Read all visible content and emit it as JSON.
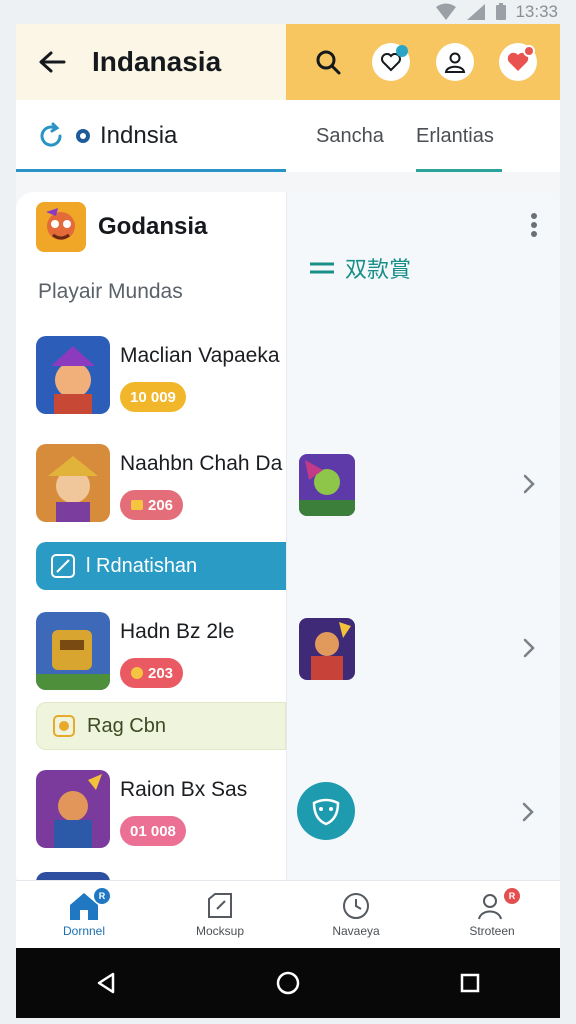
{
  "status_bar": {
    "time": "13:33"
  },
  "header": {
    "title": "Indanasia",
    "icons": [
      "back-arrow-icon",
      "search-icon",
      "heart-chat-icon",
      "profile-icon",
      "notification-heart-icon"
    ]
  },
  "tabs": {
    "active_label": "Indnsia",
    "items": [
      "Sancha",
      "Erlantias"
    ]
  },
  "game": {
    "name": "Godansia",
    "section_label": "Playair Mundas"
  },
  "list": [
    {
      "name": "Maclian Vapaeka",
      "badge": "10 009",
      "badge_color": "#f2b62a"
    },
    {
      "name": "Naahbn Chah Da",
      "badge": "206",
      "badge_color": "#e36d78"
    },
    {
      "name": "Hadn Bz 2le",
      "badge": "203",
      "badge_color": "#ea5a63"
    },
    {
      "name": "Raion Bx Sas",
      "badge": "01 008",
      "badge_color": "#ec6f94"
    }
  ],
  "banners": {
    "blue": "l Rdnatishan",
    "green": "Rag Cbn"
  },
  "panel": {
    "title": "双款賞"
  },
  "bottom_nav": [
    {
      "label": "Dornnel",
      "active": true,
      "badge": "R"
    },
    {
      "label": "Mocksup",
      "active": false,
      "badge": ""
    },
    {
      "label": "Navaeya",
      "active": false,
      "badge": ""
    },
    {
      "label": "Stroteen",
      "active": false,
      "badge": "R"
    }
  ],
  "colors": {
    "header_left": "#fbf6e6",
    "header_right": "#f7c660",
    "accent_blue": "#2a93c6",
    "accent_teal": "#1a8f8a"
  }
}
